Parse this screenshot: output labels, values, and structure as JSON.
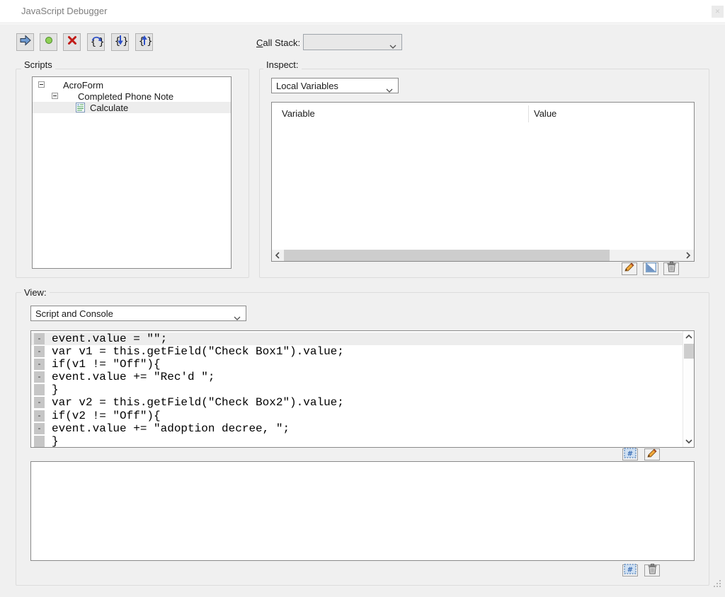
{
  "window": {
    "title": "JavaScript Debugger"
  },
  "toolbar": {
    "call_stack_mnemonic": "C",
    "call_stack_rest": "all Stack:",
    "call_stack_value": "",
    "buttons": [
      {
        "name": "resume",
        "icon": "blue-arrow-right-icon",
        "color": "#6f9bd1"
      },
      {
        "name": "record",
        "icon": "green-dot-icon",
        "color": "#8ed055"
      },
      {
        "name": "stop",
        "icon": "red-x-icon",
        "color": "#c11b17"
      },
      {
        "name": "step-over",
        "icon": "loop-arrow-braces-icon",
        "color": "#2d50c8"
      },
      {
        "name": "step-into",
        "icon": "down-arrow-braces-icon",
        "color": "#2d50c8"
      },
      {
        "name": "step-out",
        "icon": "up-arrow-braces-icon",
        "color": "#2d50c8"
      }
    ]
  },
  "scripts": {
    "label": "Scripts",
    "tree": [
      {
        "label": "AcroForm",
        "level": 0,
        "expander": "minus",
        "selected": false
      },
      {
        "label": "Completed Phone Note",
        "level": 1,
        "expander": "minus",
        "selected": false
      },
      {
        "label": "Calculate",
        "level": 2,
        "icon": "script-icon",
        "selected": true
      }
    ]
  },
  "inspect": {
    "label": "Inspect:",
    "scope_value": "Local Variables",
    "columns": {
      "variable": "Variable",
      "value": "Value"
    },
    "rows": [],
    "buttons": [
      {
        "name": "edit-value",
        "icon": "pencil-icon"
      },
      {
        "name": "insert-watch",
        "icon": "watch-icon"
      },
      {
        "name": "delete-variable",
        "icon": "trash-icon"
      }
    ]
  },
  "view": {
    "label": "View:",
    "mode_value": "Script and Console",
    "code_lines": [
      {
        "text": "event.value = \"\";",
        "marker": "-",
        "highlight": true
      },
      {
        "text": "var v1 = this.getField(\"Check Box1\").value;",
        "marker": "-",
        "highlight": false
      },
      {
        "text": "if(v1 != \"Off\"){",
        "marker": "-",
        "highlight": false
      },
      {
        "text": "event.value += \"Rec'd \";",
        "marker": "-",
        "highlight": false
      },
      {
        "text": "}",
        "marker": "",
        "highlight": false
      },
      {
        "text": "var v2 = this.getField(\"Check Box2\").value;",
        "marker": "-",
        "highlight": false
      },
      {
        "text": "if(v2 != \"Off\"){",
        "marker": "-",
        "highlight": false
      },
      {
        "text": "event.value += \"adoption decree, \";",
        "marker": "-",
        "highlight": false
      },
      {
        "text": "}",
        "marker": "",
        "highlight": false
      }
    ],
    "code_buttons": [
      {
        "name": "goto-line",
        "icon": "hash-dotted-icon"
      },
      {
        "name": "edit-script",
        "icon": "pencil-icon"
      }
    ],
    "console_value": "",
    "console_buttons": [
      {
        "name": "goto-console-line",
        "icon": "hash-icon"
      },
      {
        "name": "clear-console",
        "icon": "trash-icon"
      }
    ]
  },
  "colors": {
    "body_bg": "#f0f0f0",
    "selection": "#ededed",
    "gutter": "#c6c6c6",
    "panel_border": "#8a8a8a"
  }
}
